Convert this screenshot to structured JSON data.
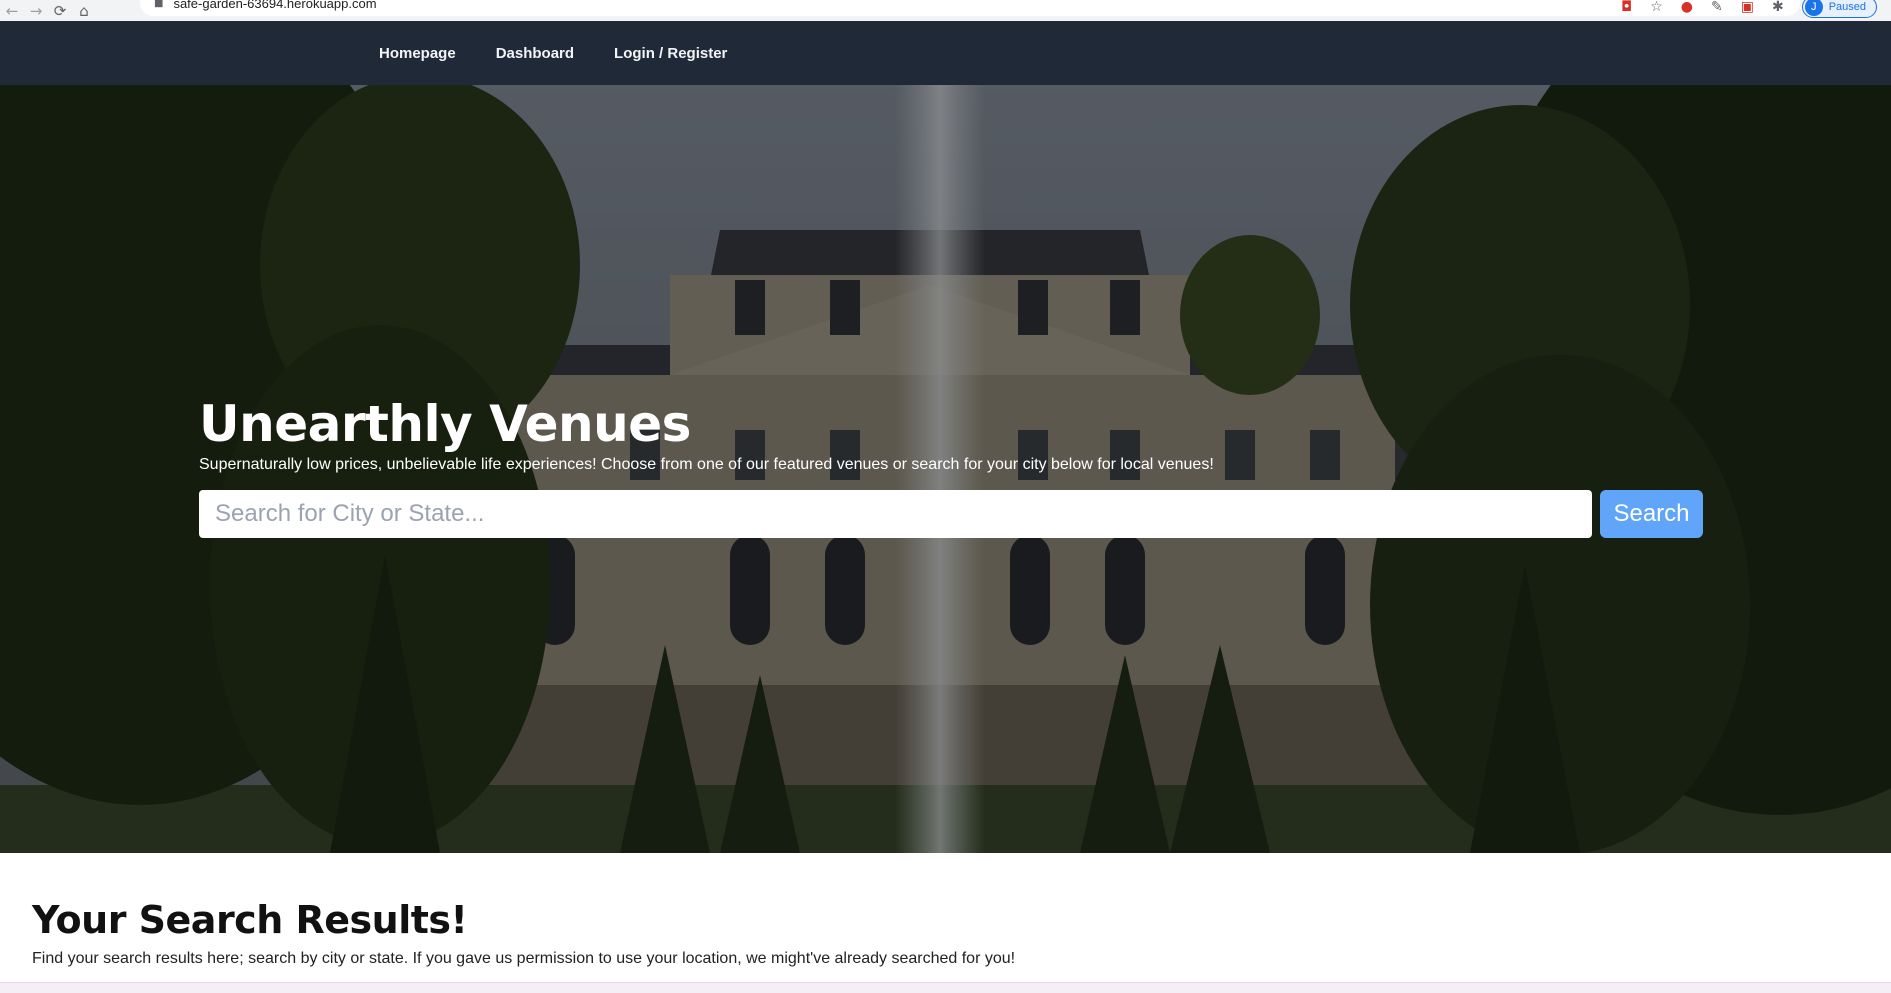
{
  "browser": {
    "url": "safe-garden-63694.herokuapp.com",
    "profile_initial": "J",
    "profile_label": "Paused",
    "back_glyph": "←",
    "forward_glyph": "→",
    "reload_glyph": "⟳",
    "home_glyph": "⌂"
  },
  "navbar": {
    "links": [
      "Homepage",
      "Dashboard",
      "Login / Register"
    ]
  },
  "hero": {
    "title": "Unearthly Venues",
    "subtitle": "Supernaturally low prices, unbelievable life experiences! Choose from one of our featured venues or search for your city below for local venues!",
    "search_placeholder": "Search for City or State...",
    "search_button": "Search"
  },
  "results": {
    "title": "Your Search Results!",
    "description": "Find your search results here; search by city or state. If you gave us permission to use your location, we might've already searched for you!"
  },
  "colors": {
    "navbar": "#1f2937",
    "search_button": "#60a5fa"
  }
}
